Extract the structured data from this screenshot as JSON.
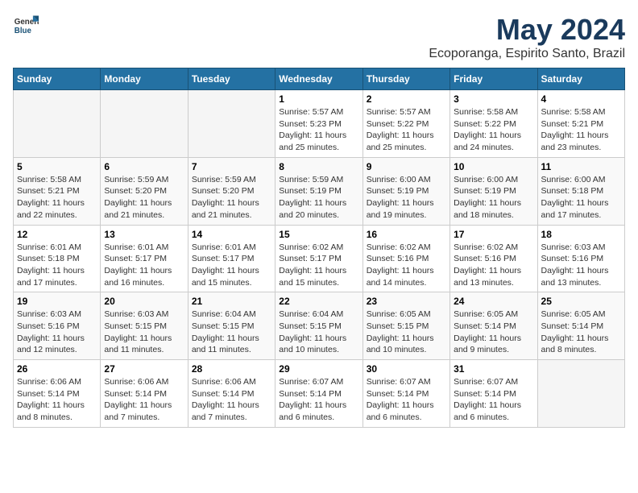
{
  "logo": {
    "general": "General",
    "blue": "Blue"
  },
  "header": {
    "month": "May 2024",
    "location": "Ecoporanga, Espirito Santo, Brazil"
  },
  "days_of_week": [
    "Sunday",
    "Monday",
    "Tuesday",
    "Wednesday",
    "Thursday",
    "Friday",
    "Saturday"
  ],
  "weeks": [
    [
      {
        "day": "",
        "info": ""
      },
      {
        "day": "",
        "info": ""
      },
      {
        "day": "",
        "info": ""
      },
      {
        "day": "1",
        "info": "Sunrise: 5:57 AM\nSunset: 5:23 PM\nDaylight: 11 hours\nand 25 minutes."
      },
      {
        "day": "2",
        "info": "Sunrise: 5:57 AM\nSunset: 5:22 PM\nDaylight: 11 hours\nand 25 minutes."
      },
      {
        "day": "3",
        "info": "Sunrise: 5:58 AM\nSunset: 5:22 PM\nDaylight: 11 hours\nand 24 minutes."
      },
      {
        "day": "4",
        "info": "Sunrise: 5:58 AM\nSunset: 5:21 PM\nDaylight: 11 hours\nand 23 minutes."
      }
    ],
    [
      {
        "day": "5",
        "info": "Sunrise: 5:58 AM\nSunset: 5:21 PM\nDaylight: 11 hours\nand 22 minutes."
      },
      {
        "day": "6",
        "info": "Sunrise: 5:59 AM\nSunset: 5:20 PM\nDaylight: 11 hours\nand 21 minutes."
      },
      {
        "day": "7",
        "info": "Sunrise: 5:59 AM\nSunset: 5:20 PM\nDaylight: 11 hours\nand 21 minutes."
      },
      {
        "day": "8",
        "info": "Sunrise: 5:59 AM\nSunset: 5:19 PM\nDaylight: 11 hours\nand 20 minutes."
      },
      {
        "day": "9",
        "info": "Sunrise: 6:00 AM\nSunset: 5:19 PM\nDaylight: 11 hours\nand 19 minutes."
      },
      {
        "day": "10",
        "info": "Sunrise: 6:00 AM\nSunset: 5:19 PM\nDaylight: 11 hours\nand 18 minutes."
      },
      {
        "day": "11",
        "info": "Sunrise: 6:00 AM\nSunset: 5:18 PM\nDaylight: 11 hours\nand 17 minutes."
      }
    ],
    [
      {
        "day": "12",
        "info": "Sunrise: 6:01 AM\nSunset: 5:18 PM\nDaylight: 11 hours\nand 17 minutes."
      },
      {
        "day": "13",
        "info": "Sunrise: 6:01 AM\nSunset: 5:17 PM\nDaylight: 11 hours\nand 16 minutes."
      },
      {
        "day": "14",
        "info": "Sunrise: 6:01 AM\nSunset: 5:17 PM\nDaylight: 11 hours\nand 15 minutes."
      },
      {
        "day": "15",
        "info": "Sunrise: 6:02 AM\nSunset: 5:17 PM\nDaylight: 11 hours\nand 15 minutes."
      },
      {
        "day": "16",
        "info": "Sunrise: 6:02 AM\nSunset: 5:16 PM\nDaylight: 11 hours\nand 14 minutes."
      },
      {
        "day": "17",
        "info": "Sunrise: 6:02 AM\nSunset: 5:16 PM\nDaylight: 11 hours\nand 13 minutes."
      },
      {
        "day": "18",
        "info": "Sunrise: 6:03 AM\nSunset: 5:16 PM\nDaylight: 11 hours\nand 13 minutes."
      }
    ],
    [
      {
        "day": "19",
        "info": "Sunrise: 6:03 AM\nSunset: 5:16 PM\nDaylight: 11 hours\nand 12 minutes."
      },
      {
        "day": "20",
        "info": "Sunrise: 6:03 AM\nSunset: 5:15 PM\nDaylight: 11 hours\nand 11 minutes."
      },
      {
        "day": "21",
        "info": "Sunrise: 6:04 AM\nSunset: 5:15 PM\nDaylight: 11 hours\nand 11 minutes."
      },
      {
        "day": "22",
        "info": "Sunrise: 6:04 AM\nSunset: 5:15 PM\nDaylight: 11 hours\nand 10 minutes."
      },
      {
        "day": "23",
        "info": "Sunrise: 6:05 AM\nSunset: 5:15 PM\nDaylight: 11 hours\nand 10 minutes."
      },
      {
        "day": "24",
        "info": "Sunrise: 6:05 AM\nSunset: 5:14 PM\nDaylight: 11 hours\nand 9 minutes."
      },
      {
        "day": "25",
        "info": "Sunrise: 6:05 AM\nSunset: 5:14 PM\nDaylight: 11 hours\nand 8 minutes."
      }
    ],
    [
      {
        "day": "26",
        "info": "Sunrise: 6:06 AM\nSunset: 5:14 PM\nDaylight: 11 hours\nand 8 minutes."
      },
      {
        "day": "27",
        "info": "Sunrise: 6:06 AM\nSunset: 5:14 PM\nDaylight: 11 hours\nand 7 minutes."
      },
      {
        "day": "28",
        "info": "Sunrise: 6:06 AM\nSunset: 5:14 PM\nDaylight: 11 hours\nand 7 minutes."
      },
      {
        "day": "29",
        "info": "Sunrise: 6:07 AM\nSunset: 5:14 PM\nDaylight: 11 hours\nand 6 minutes."
      },
      {
        "day": "30",
        "info": "Sunrise: 6:07 AM\nSunset: 5:14 PM\nDaylight: 11 hours\nand 6 minutes."
      },
      {
        "day": "31",
        "info": "Sunrise: 6:07 AM\nSunset: 5:14 PM\nDaylight: 11 hours\nand 6 minutes."
      },
      {
        "day": "",
        "info": ""
      }
    ]
  ]
}
